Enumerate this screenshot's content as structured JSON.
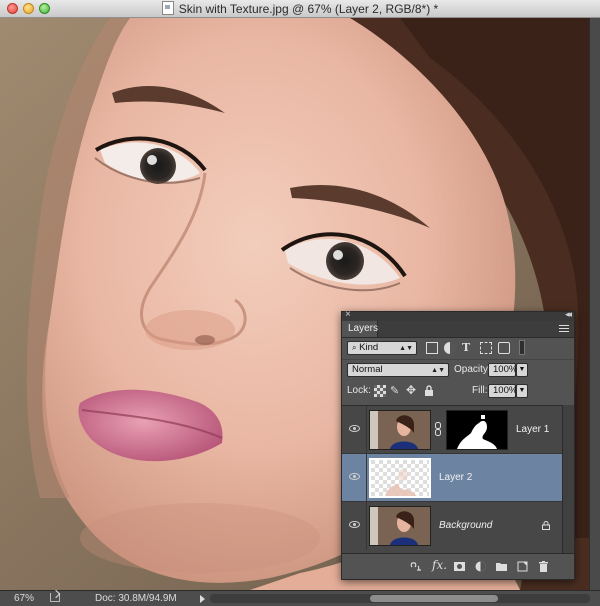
{
  "window": {
    "title": "Skin with Texture.jpg @ 67% (Layer 2, RGB/8*) *"
  },
  "status_bar": {
    "zoom": "67%",
    "doc_info": "Doc: 30.8M/94.9M"
  },
  "layers_panel": {
    "tab_label": "Layers",
    "filter_kind": "Kind",
    "blend_mode": "Normal",
    "opacity_label": "Opacity:",
    "opacity_value": "100%",
    "lock_label": "Lock:",
    "fill_label": "Fill:",
    "fill_value": "100%",
    "layers": [
      {
        "name": "Layer 1",
        "visible": true,
        "has_mask": true,
        "selected": false
      },
      {
        "name": "Layer 2",
        "visible": true,
        "has_mask": false,
        "selected": true
      },
      {
        "name": "Background",
        "visible": true,
        "has_mask": false,
        "selected": false,
        "locked": true
      }
    ]
  },
  "colors": {
    "selection": "#6c84a1",
    "panel": "#535353",
    "lips": "#c96a88"
  }
}
